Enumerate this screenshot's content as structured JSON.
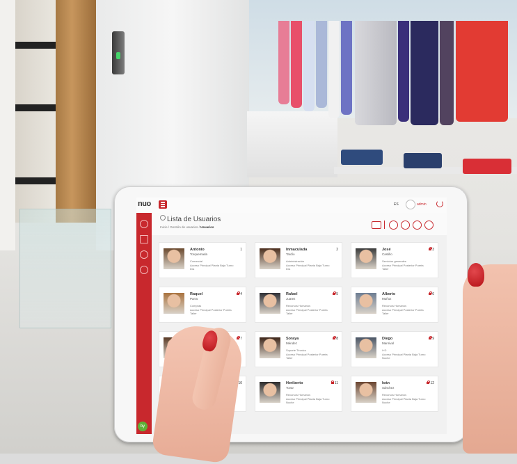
{
  "app": {
    "logo": "nuo",
    "title": "Lista de Usuarios",
    "breadcrumb": [
      "Inicio",
      "Gestión de usuarios",
      "Usuarios"
    ],
    "language": "ES",
    "user": "admin",
    "footer_badge": "by",
    "accent_color": "#c8282d"
  },
  "toolbar_icons": [
    "list-icon",
    "camera-icon",
    "refresh-icon",
    "sync-icon",
    "back-icon"
  ],
  "sidebar_icons": [
    "dashboard-icon",
    "document-icon",
    "search-icon",
    "settings-icon"
  ],
  "users": [
    {
      "first": "Antonio",
      "last": "Torquemada",
      "dept": "Comercial",
      "access": "Acceso Principal Planta Baja Turno",
      "shift": "Día",
      "num": "1",
      "locked": false,
      "photo_color": "#6b4a2f"
    },
    {
      "first": "Inmaculada",
      "last": "Tardío",
      "dept": "Administración",
      "access": "Acceso Principal Planta Baja Turno",
      "shift": "Día",
      "num": "2",
      "locked": false,
      "photo_color": "#4b2e1d"
    },
    {
      "first": "José",
      "last": "Castillo",
      "dept": "Servicios generales",
      "access": "Acceso Principal Posterior Puerta",
      "shift": "Taller",
      "num": "3",
      "locked": true,
      "photo_color": "#3b3b3b"
    },
    {
      "first": "Raquel",
      "last": "Parra",
      "dept": "Compras",
      "access": "Acceso Principal Posterior Puerta",
      "shift": "Taller",
      "num": "4",
      "locked": true,
      "photo_color": "#a9733f"
    },
    {
      "first": "Rafael",
      "last": "Juarez",
      "dept": "Recursos Humanos",
      "access": "Acceso Principal Posterior Puerta",
      "shift": "Taller",
      "num": "5",
      "locked": true,
      "photo_color": "#2f2f35"
    },
    {
      "first": "Alberto",
      "last": "Muñoz",
      "dept": "Recursos Humanos",
      "access": "Acceso Principal Posterior Puerta",
      "shift": "Taller",
      "num": "6",
      "locked": true,
      "photo_color": "#6d7d92"
    },
    {
      "first": "Tamara",
      "last": "Ot...",
      "dept": "",
      "access": "Acceso Principal Posterior Puerta",
      "shift": "",
      "num": "7",
      "locked": true,
      "photo_color": "#5a3a25"
    },
    {
      "first": "Soraya",
      "last": "Méndez",
      "dept": "Soporte Técnico",
      "access": "Acceso Principal Posterior Puerta",
      "shift": "Taller",
      "num": "8",
      "locked": true,
      "photo_color": "#3c2418"
    },
    {
      "first": "Diego",
      "last": "Manrival",
      "dept": "I+D",
      "access": "Acceso Principal Planta Baja Turno",
      "shift": "Noche",
      "num": "9",
      "locked": true,
      "photo_color": "#4a5565"
    },
    {
      "first": "",
      "last": "",
      "dept": "",
      "access": "Acceso Principal Planta Baja Turno",
      "shift": "",
      "num": "10",
      "locked": true,
      "photo_color": "#8b5a3a"
    },
    {
      "first": "Heriberto",
      "last": "Tovar",
      "dept": "Recursos Humanos",
      "access": "Acceso Principal Planta Baja Turno",
      "shift": "Noche",
      "num": "11",
      "locked": true,
      "photo_color": "#2d2b2b"
    },
    {
      "first": "Iván",
      "last": "Sánchez",
      "dept": "Recursos Humanos",
      "access": "Acceso Principal Planta Baja Turno",
      "shift": "Noche",
      "num": "12",
      "locked": true,
      "photo_color": "#6b4530"
    }
  ]
}
